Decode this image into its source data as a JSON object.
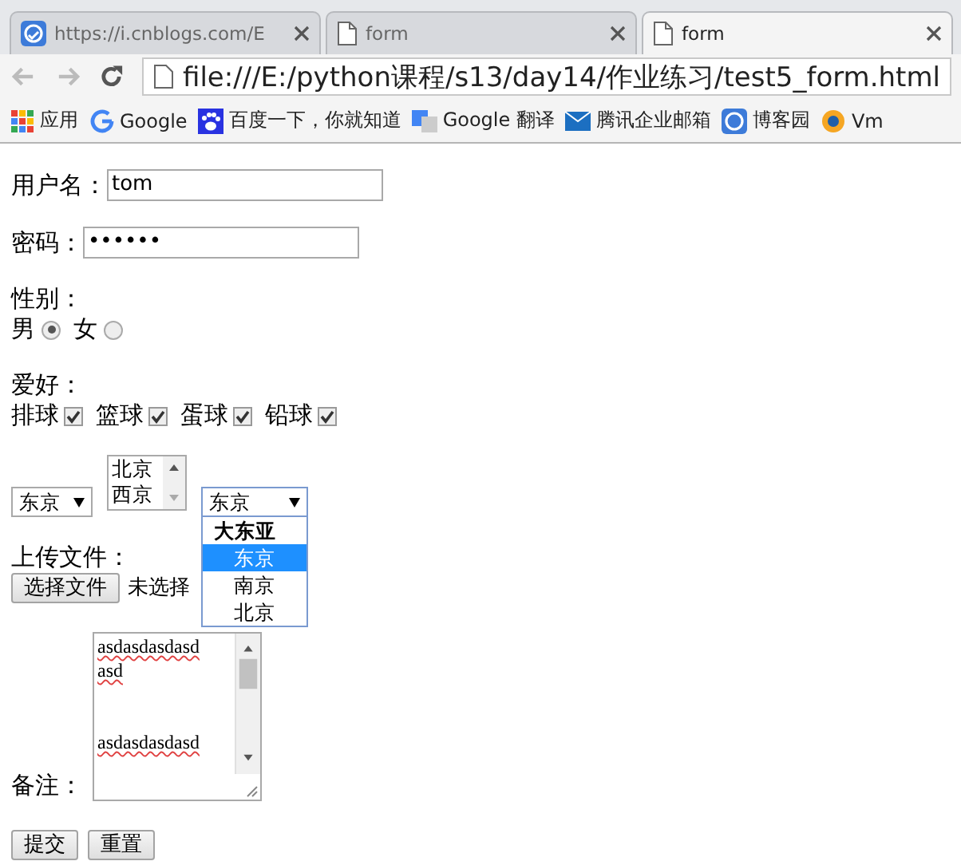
{
  "browser": {
    "tabs": [
      {
        "title": "https://i.cnblogs.com/E",
        "kind": "site",
        "selected": false
      },
      {
        "title": "form",
        "kind": "page",
        "selected": false
      },
      {
        "title": "form",
        "kind": "page",
        "selected": true
      }
    ],
    "address": "file:///E:/python课程/s13/day14/作业练习/test5_form.html",
    "bookmarks": [
      {
        "label": "应用",
        "kind": "apps"
      },
      {
        "label": "Google",
        "kind": "google"
      },
      {
        "label": "百度一下，你就知道",
        "kind": "paw"
      },
      {
        "label": "Google 翻译",
        "kind": "translate"
      },
      {
        "label": "腾讯企业邮箱",
        "kind": "mail"
      },
      {
        "label": "博客园",
        "kind": "site"
      },
      {
        "label": "Vm",
        "kind": "vm"
      }
    ]
  },
  "form": {
    "username": {
      "label": "用户名：",
      "value": "tom"
    },
    "password": {
      "label": "密码：",
      "value": "••••••"
    },
    "gender": {
      "label": "性别：",
      "options": [
        {
          "label": "男",
          "selected": true
        },
        {
          "label": "女",
          "selected": false
        }
      ]
    },
    "hobbies": {
      "label": "爱好：",
      "options": [
        {
          "label": "排球",
          "checked": true
        },
        {
          "label": "篮球",
          "checked": true
        },
        {
          "label": "蛋球",
          "checked": true
        },
        {
          "label": "铅球",
          "checked": true
        }
      ]
    },
    "city_select": {
      "value": "东京"
    },
    "city_list": {
      "options": [
        {
          "label": "北京",
          "selected": false
        },
        {
          "label": "西京",
          "selected": false
        }
      ]
    },
    "grouped_select": {
      "value": "东京",
      "expanded": true,
      "items": [
        {
          "kind": "group",
          "label": "大东亚"
        },
        {
          "kind": "option",
          "label": "东京",
          "selected": true
        },
        {
          "kind": "option",
          "label": "南京",
          "selected": false
        },
        {
          "kind": "option",
          "label": "北京",
          "selected": false
        }
      ]
    },
    "upload": {
      "label": "上传文件：",
      "button": "选择文件",
      "status": "未选择"
    },
    "remark": {
      "label": "备注：",
      "value": "asdasdasdasd\nasd\n\n\nasdasdasdasd"
    },
    "buttons": [
      "提交",
      "重置"
    ]
  }
}
